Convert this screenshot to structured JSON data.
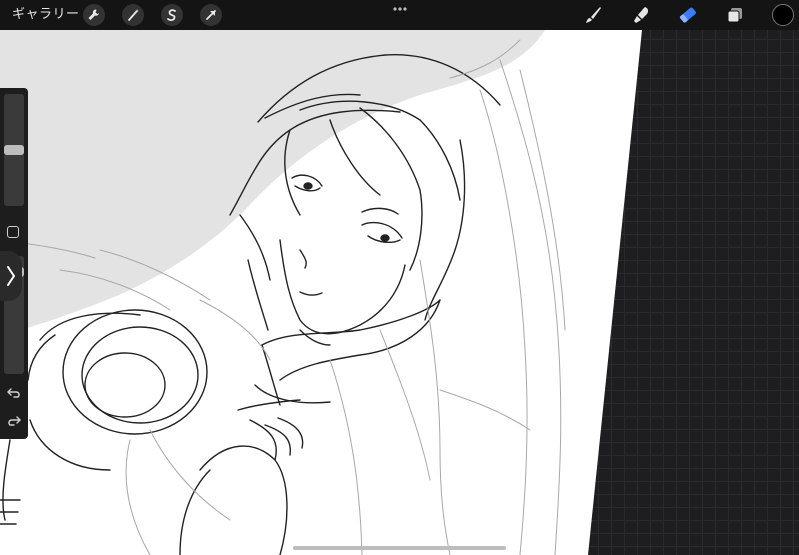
{
  "toolbar": {
    "gallery_label": "ギャラリー",
    "left_tools": [
      "wrench-icon",
      "magic-wand-icon",
      "selection-icon",
      "transform-arrow-icon"
    ],
    "right_tools": [
      "brush-icon",
      "smudge-icon",
      "eraser-icon",
      "layers-icon"
    ],
    "active_tool": "eraser",
    "current_color": "#000000",
    "accent": "#3a7bff"
  },
  "sidebar": {
    "brush_size": 0.5,
    "brush_opacity": 0.9,
    "icons": [
      "modify-square-icon",
      "undo-icon",
      "redo-icon",
      "sidebar-expand-icon"
    ]
  },
  "canvas": {
    "paper_color": "#ffffff",
    "background_fill": "#e3e3e3",
    "line_color": "#1a1a1a"
  }
}
